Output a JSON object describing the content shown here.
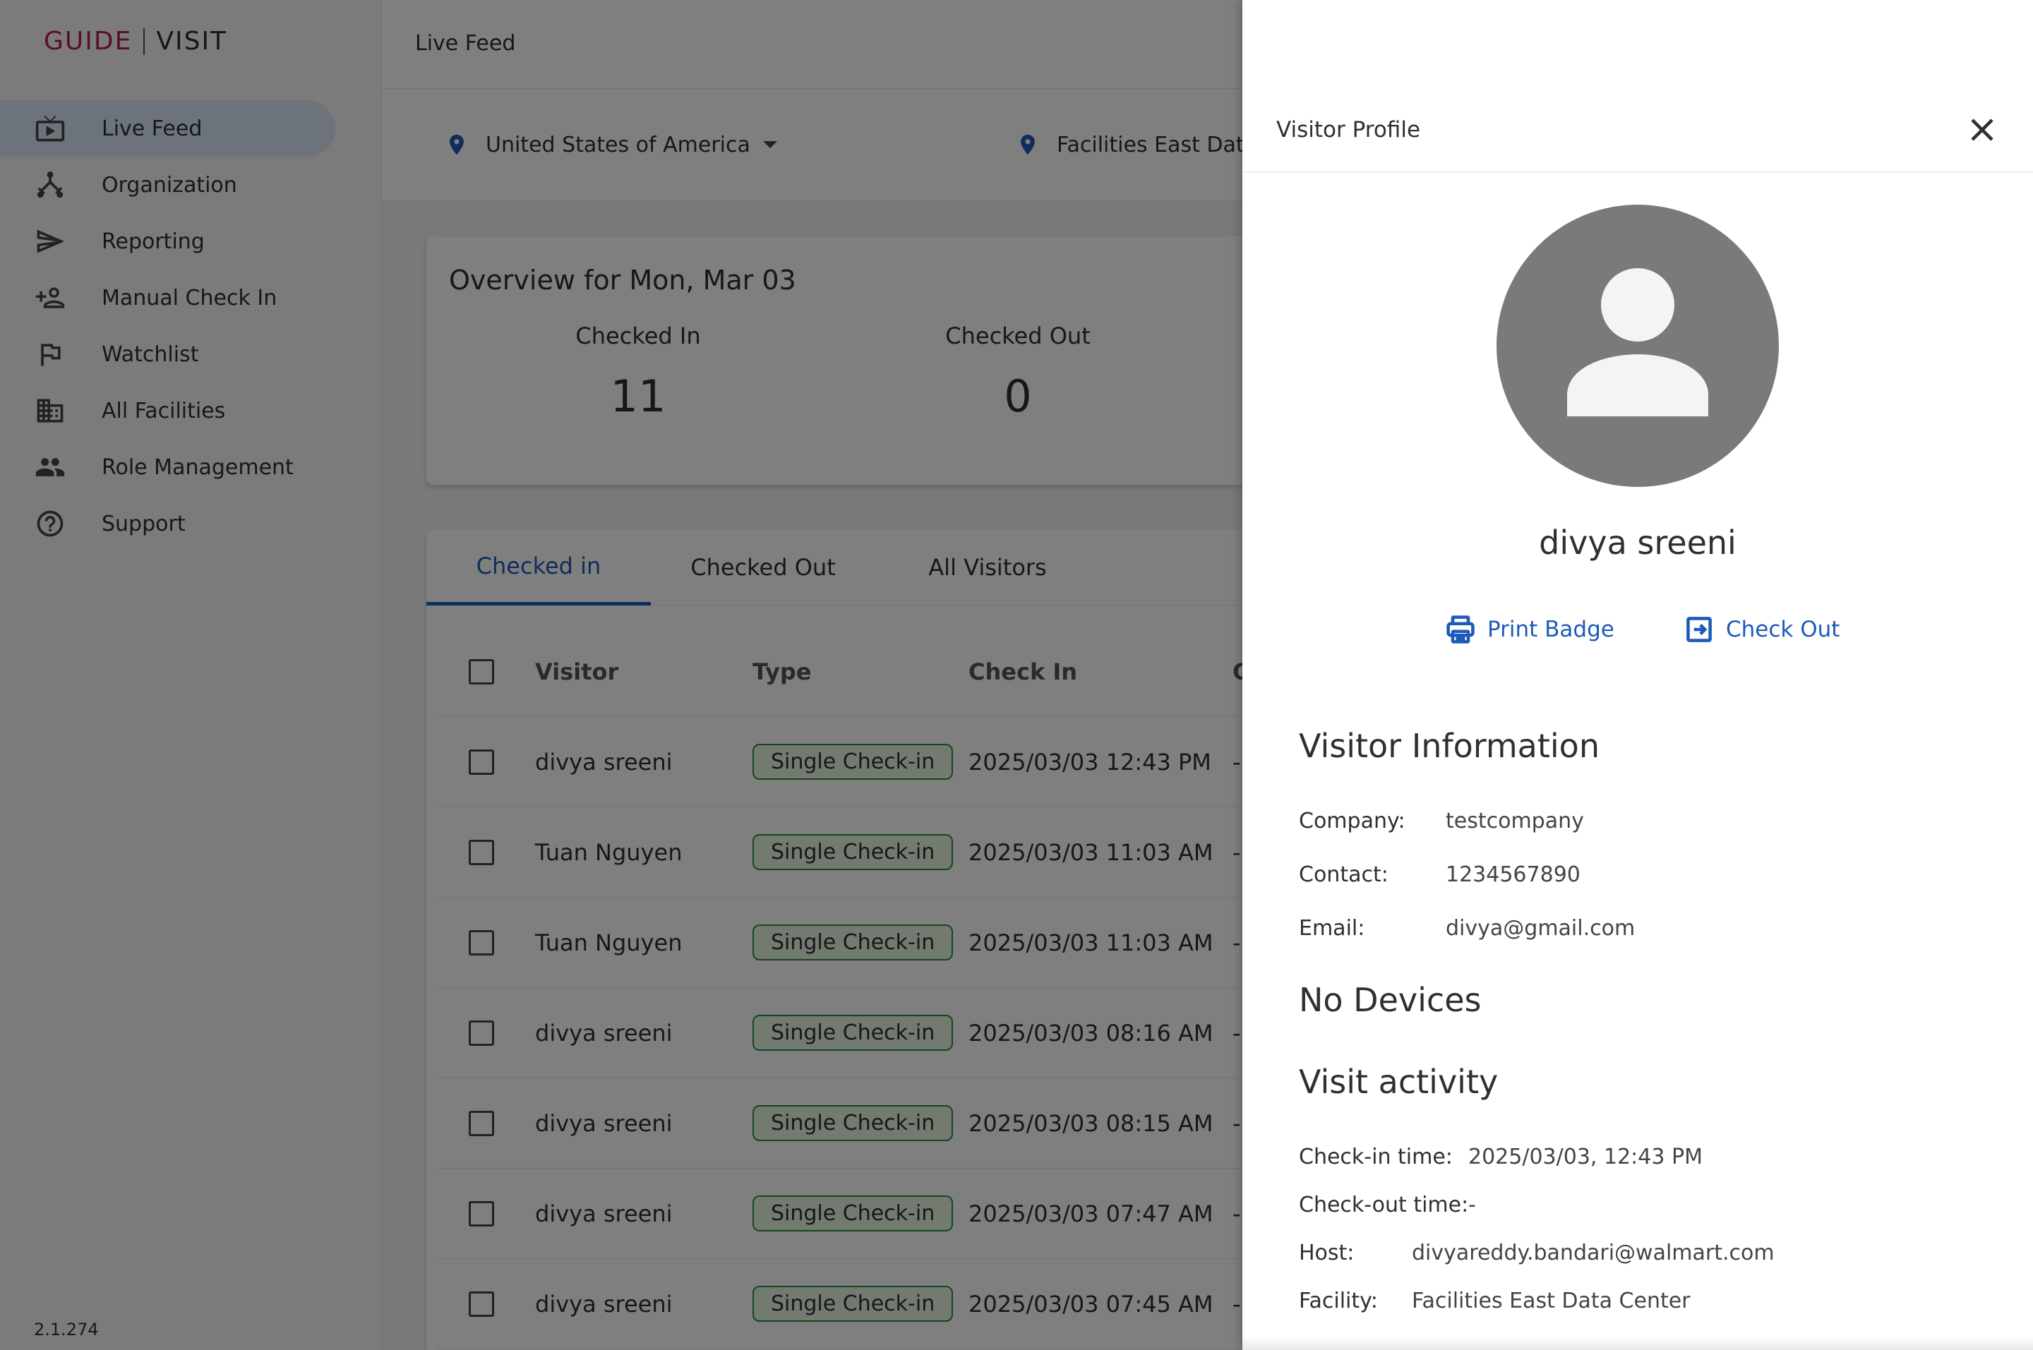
{
  "app": {
    "brand": "GUIDE",
    "name": "VISIT",
    "version": "2.1.274",
    "brand_color": "#b51d5a",
    "accent_color": "#1e5ab8"
  },
  "sidebar": {
    "items": [
      {
        "label": "Live Feed",
        "icon": "live-tv-icon",
        "active": true
      },
      {
        "label": "Organization",
        "icon": "organization-icon"
      },
      {
        "label": "Reporting",
        "icon": "send-icon"
      },
      {
        "label": "Manual Check In",
        "icon": "add-people-icon"
      },
      {
        "label": "Watchlist",
        "icon": "flag-icon"
      },
      {
        "label": "All Facilities",
        "icon": "building-icon"
      },
      {
        "label": "Role Management",
        "icon": "people-icon"
      },
      {
        "label": "Support",
        "icon": "help-icon"
      }
    ]
  },
  "header": {
    "title": "Live Feed"
  },
  "filters": {
    "country": "United States of America",
    "facility": "Facilities East Data"
  },
  "overview": {
    "title": "Overview for Mon, Mar 03",
    "checked_in_label": "Checked In",
    "checked_in_value": "11",
    "checked_out_label": "Checked Out",
    "checked_out_value": "0"
  },
  "tabs": [
    "Checked in",
    "Checked Out",
    "All Visitors"
  ],
  "table": {
    "columns": {
      "visitor": "Visitor",
      "type": "Type",
      "check_in": "Check In",
      "extra": "C"
    },
    "rows": [
      {
        "visitor": "divya sreeni",
        "type": "Single Check-in",
        "check_in": "2025/03/03 12:43 PM",
        "extra": "-"
      },
      {
        "visitor": "Tuan Nguyen",
        "type": "Single Check-in",
        "check_in": "2025/03/03 11:03 AM",
        "extra": "-"
      },
      {
        "visitor": "Tuan Nguyen",
        "type": "Single Check-in",
        "check_in": "2025/03/03 11:03 AM",
        "extra": "-"
      },
      {
        "visitor": "divya sreeni",
        "type": "Single Check-in",
        "check_in": "2025/03/03 08:16 AM",
        "extra": "-"
      },
      {
        "visitor": "divya sreeni",
        "type": "Single Check-in",
        "check_in": "2025/03/03 08:15 AM",
        "extra": "-"
      },
      {
        "visitor": "divya sreeni",
        "type": "Single Check-in",
        "check_in": "2025/03/03 07:47 AM",
        "extra": "-"
      },
      {
        "visitor": "divya sreeni",
        "type": "Single Check-in",
        "check_in": "2025/03/03 07:45 AM",
        "extra": "-"
      }
    ]
  },
  "panel": {
    "title": "Visitor Profile",
    "name": "divya sreeni",
    "print_badge": "Print Badge",
    "check_out": "Check Out",
    "info_title": "Visitor Information",
    "company_label": "Company:",
    "company": "testcompany",
    "contact_label": "Contact:",
    "contact": "1234567890",
    "email_label": "Email:",
    "email": "divya@gmail.com",
    "devices_title": "No Devices",
    "activity_title": "Visit activity",
    "checkin_label": "Check-in time:",
    "checkin": "2025/03/03, 12:43 PM",
    "checkout_label": "Check-out time:",
    "checkout": "-",
    "host_label": "Host:",
    "host": "divyareddy.bandari@walmart.com",
    "facility_label": "Facility:",
    "facility": "Facilities East Data Center"
  }
}
